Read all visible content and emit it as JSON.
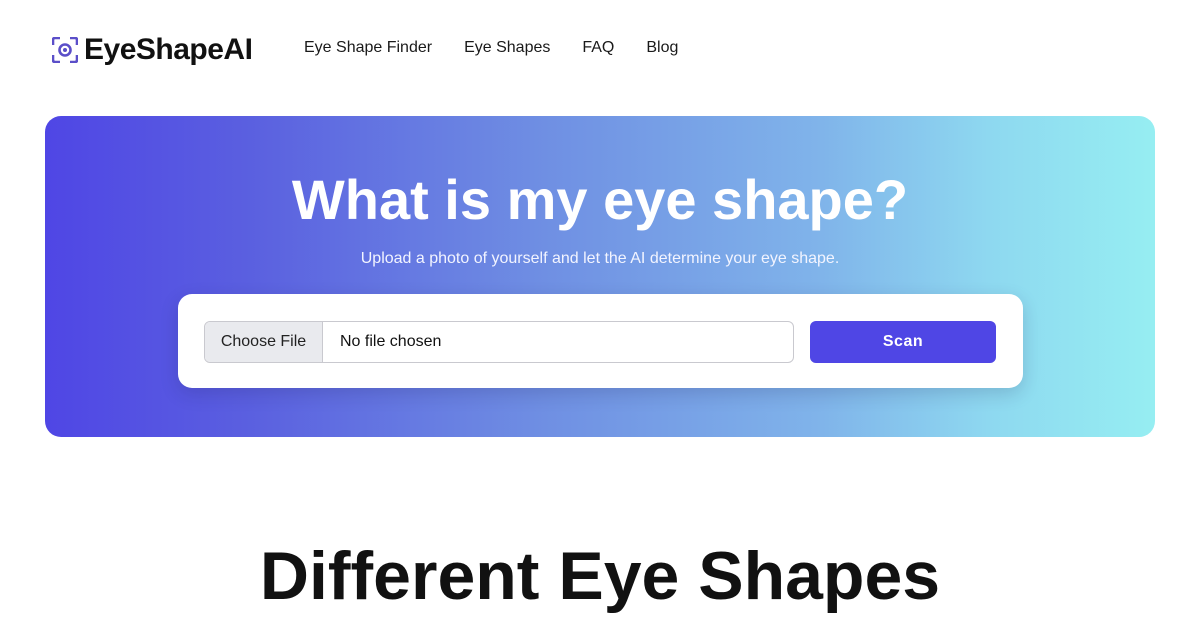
{
  "brand": {
    "name": "EyeShapeAI",
    "icon": "eye-scan-icon",
    "accent": "#4f46e5"
  },
  "nav": {
    "items": [
      {
        "label": "Eye Shape Finder"
      },
      {
        "label": "Eye Shapes"
      },
      {
        "label": "FAQ"
      },
      {
        "label": "Blog"
      }
    ]
  },
  "hero": {
    "title": "What is my eye shape?",
    "subtitle": "Upload a photo of yourself and let the AI determine your eye shape.",
    "gradient": [
      "#4f46e5",
      "#96eef2"
    ],
    "upload": {
      "choose_label": "Choose File",
      "status": "No file chosen",
      "scan_label": "Scan"
    }
  },
  "section": {
    "title": "Different Eye Shapes"
  }
}
